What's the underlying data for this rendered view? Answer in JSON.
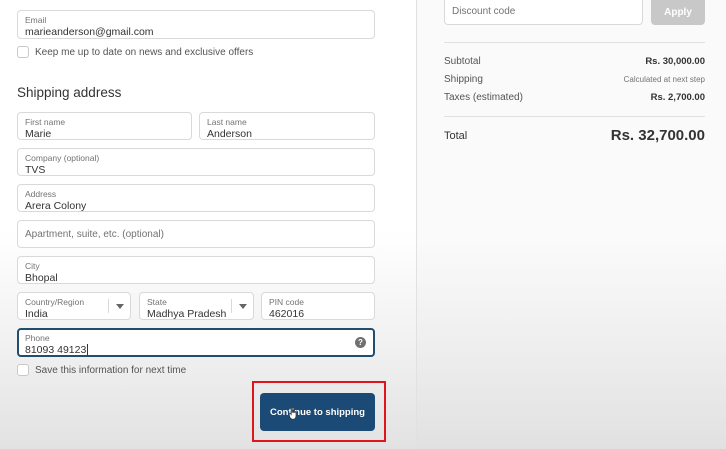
{
  "contact": {
    "email_label": "Email",
    "email_value": "marieanderson@gmail.com",
    "newsletter_label": "Keep me up to date on news and exclusive offers"
  },
  "shipping": {
    "heading": "Shipping address",
    "first_name_label": "First name",
    "first_name_value": "Marie",
    "last_name_label": "Last name",
    "last_name_value": "Anderson",
    "company_label": "Company (optional)",
    "company_value": "TVS",
    "address_label": "Address",
    "address_value": "Arera Colony",
    "apartment_placeholder": "Apartment, suite, etc. (optional)",
    "city_label": "City",
    "city_value": "Bhopal",
    "country_label": "Country/Region",
    "country_value": "India",
    "state_label": "State",
    "state_value": "Madhya Pradesh",
    "pin_label": "PIN code",
    "pin_value": "462016",
    "phone_label": "Phone",
    "phone_value": "81093 49123",
    "phone_help_icon": "?",
    "save_info_label": "Save this information for next time",
    "continue_label": "Continue to shipping"
  },
  "summary": {
    "discount_placeholder": "Discount code",
    "apply_label": "Apply",
    "subtotal_label": "Subtotal",
    "subtotal_value": "Rs. 30,000.00",
    "shipping_label": "Shipping",
    "shipping_value": "Calculated at next step",
    "taxes_label": "Taxes (estimated)",
    "taxes_value": "Rs. 2,700.00",
    "total_label": "Total",
    "total_value": "Rs. 32,700.00"
  },
  "icons": {
    "dropdown": "chevron-down-icon",
    "help": "help-circle-icon",
    "cursor": "hand-pointer-icon"
  },
  "colors": {
    "primary_button": "#1a4a75",
    "focus_border": "#1f4e6f",
    "annotation_box": "#e0141b",
    "apply_disabled": "#c8c8c8"
  }
}
